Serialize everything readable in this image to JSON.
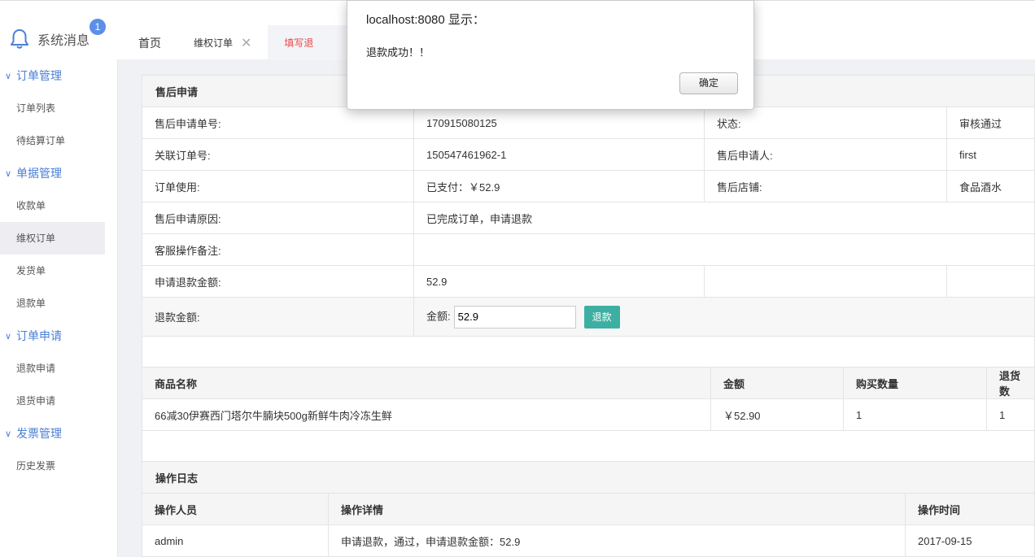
{
  "header": {
    "brand_label": "系统消息",
    "badge_count": "1",
    "tabs": [
      {
        "label": "首页"
      },
      {
        "label": "维权订单",
        "close": "✕"
      },
      {
        "label": "填写退"
      }
    ]
  },
  "sidebar": {
    "groups": [
      {
        "label": "订单管理",
        "items": [
          "订单列表",
          "待结算订单"
        ]
      },
      {
        "label": "单据管理",
        "items": [
          "收款单",
          "维权订单",
          "发货单",
          "退款单"
        ]
      },
      {
        "label": "订单申请",
        "items": [
          "退款申请",
          "退货申请"
        ]
      },
      {
        "label": "发票管理",
        "items": [
          "历史发票"
        ]
      }
    ]
  },
  "aftersale": {
    "title": "售后申请",
    "rows": [
      [
        "售后申请单号:",
        "170915080125",
        "状态:",
        "审核通过"
      ],
      [
        "关联订单号:",
        "150547461962-1",
        "售后申请人:",
        "first"
      ],
      [
        "订单使用:",
        "已支付：￥52.9",
        "售后店铺:",
        "食品酒水"
      ],
      [
        "售后申请原因:",
        "已完成订单，申请退款"
      ],
      [
        "客服操作备注:",
        ""
      ],
      [
        "申请退款金额:",
        "52.9",
        "",
        ""
      ]
    ],
    "refund_label": "退款金额:",
    "amount_label": "金额:",
    "amount_value": "52.9",
    "refund_button": "退款"
  },
  "products": {
    "headers": [
      "商品名称",
      "金额",
      "购买数量",
      "退货数"
    ],
    "rows": [
      [
        "66减30伊赛西门塔尔牛腩块500g新鲜牛肉冷冻生鲜",
        "￥52.90",
        "1",
        "1"
      ]
    ]
  },
  "log": {
    "title": "操作日志",
    "headers": [
      "操作人员",
      "操作详情",
      "操作时间"
    ],
    "rows": [
      [
        "admin",
        "申请退款，通过，申请退款金额：52.9",
        "2017-09-15"
      ]
    ]
  },
  "dialog": {
    "title": "localhost:8080 显示：",
    "message": "退款成功！！",
    "ok": "确定"
  }
}
